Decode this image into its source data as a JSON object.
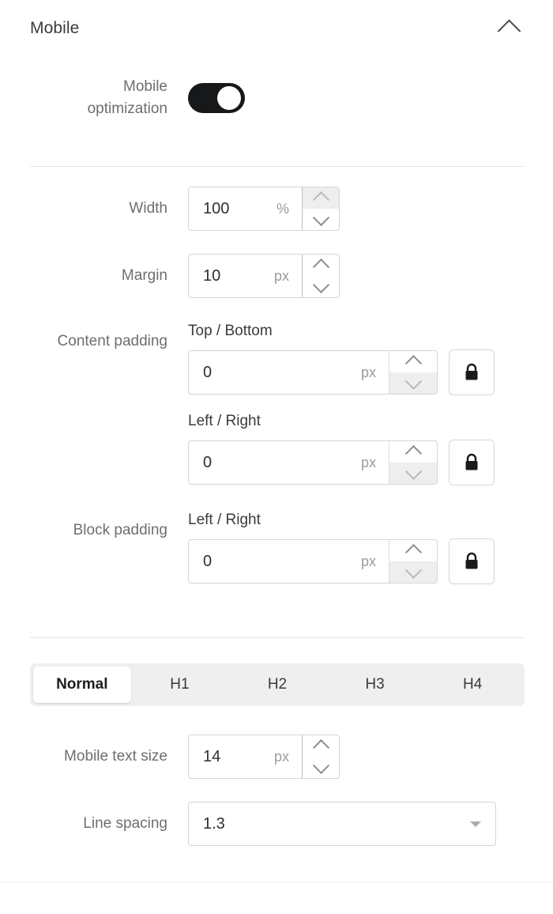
{
  "panel": {
    "title": "Mobile",
    "collapse_icon": "chevron-up-icon"
  },
  "mobile_optimization": {
    "label_line1": "Mobile",
    "label_line2": "optimization",
    "state": "on",
    "toggle_on_color": "#16181a",
    "knob_color": "#ffffff"
  },
  "width": {
    "label": "Width",
    "value": "100",
    "unit": "%",
    "spinner_hover": "up"
  },
  "margin": {
    "label": "Margin",
    "value": "10",
    "unit": "px",
    "spinner_hover": "none"
  },
  "content_padding": {
    "label": "Content padding",
    "top_bottom": {
      "sublabel": "Top / Bottom",
      "value": "0",
      "unit": "px",
      "spinner_hover": "down",
      "lock_icon": "lock-closed-icon"
    },
    "left_right": {
      "sublabel": "Left / Right",
      "value": "0",
      "unit": "px",
      "spinner_hover": "down",
      "lock_icon": "lock-closed-icon"
    }
  },
  "block_padding": {
    "label": "Block padding",
    "left_right": {
      "sublabel": "Left / Right",
      "value": "0",
      "unit": "px",
      "spinner_hover": "down",
      "lock_icon": "lock-closed-icon"
    }
  },
  "style_tabs": {
    "items": [
      {
        "label": "Normal",
        "active": true
      },
      {
        "label": "H1",
        "active": false
      },
      {
        "label": "H2",
        "active": false
      },
      {
        "label": "H3",
        "active": false
      },
      {
        "label": "H4",
        "active": false
      }
    ]
  },
  "mobile_text_size": {
    "label": "Mobile text size",
    "value": "14",
    "unit": "px",
    "spinner_hover": "none"
  },
  "line_spacing": {
    "label": "Line spacing",
    "value": "1.3",
    "dropdown_icon": "triangle-down-icon"
  },
  "colors": {
    "background": "#ffffff",
    "label_text": "#6e6e6e",
    "value_text": "#2f2f2f",
    "unit_text": "#9b9b9b",
    "border": "#d6d6d6",
    "divider": "#e6e6e6",
    "tabbar_bg": "#efefef",
    "accent_dark": "#16181a"
  }
}
